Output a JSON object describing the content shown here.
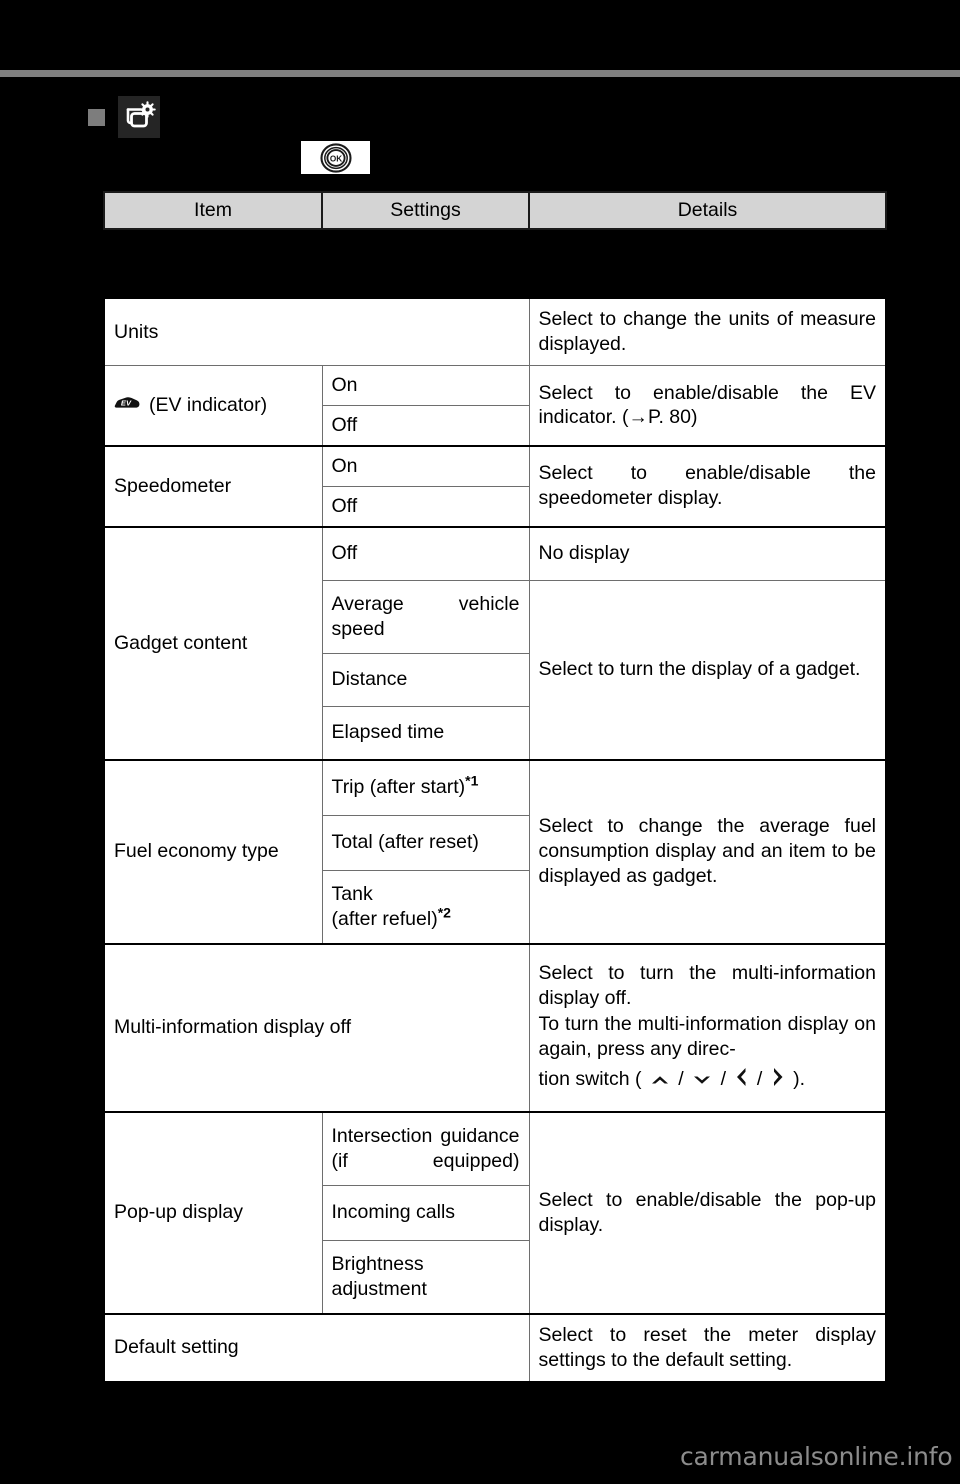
{
  "page": {
    "background_color": "#000000",
    "rule_color": "#808080",
    "bullet_color": "#7d7d7d"
  },
  "heading": {
    "bullet_icon": "square-bullet-icon",
    "display_settings_icon": "display-settings-icon",
    "ok_button_icon": "ok-button-icon",
    "ok_button_label": "OK"
  },
  "table": {
    "columns": [
      {
        "label": "Item"
      },
      {
        "label": "Settings"
      },
      {
        "label": "Details"
      }
    ],
    "rows": [
      {
        "item": "Units",
        "item_icon": null,
        "settings": [],
        "details": "Select to change the units of measure displayed.",
        "details_justify": true
      },
      {
        "item": "(EV indicator)",
        "item_icon": "ev-indicator-icon",
        "settings": [
          "On",
          "Off"
        ],
        "details": "Select to enable/disable the EV indicator. (→P. 80)",
        "details_justify": true
      },
      {
        "item": "Speedometer",
        "item_icon": null,
        "settings": [
          "On",
          "Off"
        ],
        "details": "Select to enable/disable the speedometer display.",
        "details_justify": true
      },
      {
        "item": "Gadget content",
        "item_icon": null,
        "settings": [
          "Off",
          "Average vehicle speed",
          "Distance",
          "Elapsed time"
        ],
        "details_first": "No display",
        "details": "Select to turn the display of a gadget.",
        "details_justify": true
      },
      {
        "item": "Fuel economy type",
        "item_icon": null,
        "settings": [
          "Trip (after start)",
          "Total (after reset)",
          "Tank\n(after refuel)"
        ],
        "settings_footnotes": [
          "*1",
          "",
          "*2"
        ],
        "details": "Select to change the average fuel consumption display and an item to be displayed as gadget.",
        "details_justify": true
      },
      {
        "item": "Multi-information display off",
        "item_icon": null,
        "settings": [],
        "details_lines": [
          "Select to turn the multi-informa-tion display off.",
          "To turn the multi-information dis-play on again, press any direc-tion switch ( ∧ / ∨ / ‹ / › )."
        ],
        "details_para1": "Select to turn the multi-information display off.",
        "details_para2_a": "To turn the multi-information display on again, press any direc-",
        "details_para2_b": "tion switch (",
        "details_para2_c": ").",
        "arrow_icons": [
          "chevron-up-icon",
          "chevron-down-icon",
          "chevron-left-icon",
          "chevron-right-icon"
        ],
        "details_justify": true
      },
      {
        "item": "Pop-up display",
        "item_icon": null,
        "settings": [
          "Intersection guidance (if equipped)",
          "Incoming calls",
          "Brightness adjustment"
        ],
        "details": "Select to enable/disable the pop-up display.",
        "details_justify": true
      },
      {
        "item": "Default setting",
        "item_icon": null,
        "settings": [],
        "details": "Select to reset the meter display settings to the default setting.",
        "details_justify": true
      }
    ]
  },
  "footer": {
    "watermark": "carmanualsonline.info"
  }
}
